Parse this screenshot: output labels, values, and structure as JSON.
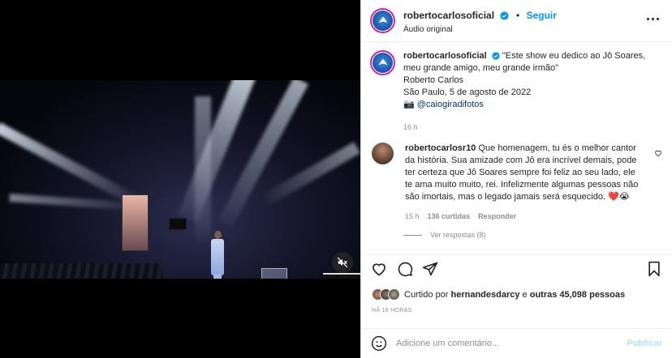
{
  "post": {
    "username": "robertocarlosoficial",
    "follow_label": "Seguir",
    "audio_label": "Áudio original",
    "separator": "•"
  },
  "caption": {
    "username": "robertocarlosoficial",
    "quote": "\"Este show eu dedico ao Jô Soares, meu grande amigo, meu grande irmão\"",
    "author": "Roberto Carlos",
    "place_date": "São Paulo, 5 de agosto de 2022",
    "camera_emoji": "📷",
    "mention": "@caiogiradifotos",
    "time": "16 h"
  },
  "comment": {
    "username": "robertocarlosr10",
    "text": "Que homenagem, tu és o melhor cantor da história. Sua amizade com Jô era incrível demais, pode ter certeza que Jô Soares sempre foi feliz ao seu lado, ele te ama muito muito, rei. Infelizmente algumas pessoas não são imortais, mas o legado jamais será esquecido.",
    "emojis": "❤️😭",
    "time": "15 h",
    "likes": "136 curtidas",
    "reply_label": "Responder",
    "view_replies": "Ver respostas (8)"
  },
  "likes": {
    "prefix": "Curtido por",
    "user": "hernandesdarcy",
    "middle": "e",
    "others": "outras 45,098 pessoas"
  },
  "post_time": "HÁ 16 HORAS",
  "add_comment": {
    "placeholder": "Adicione um comentário...",
    "publish_label": "Publicar"
  },
  "colors": {
    "accent": "#0095f6",
    "verified": "#0095f6",
    "publish_disabled": "#b2dffc",
    "avatar_ring": "#d6249f"
  },
  "icons": [
    "heart-icon",
    "comment-icon",
    "share-icon",
    "bookmark-icon",
    "emoji-icon",
    "more-options-icon",
    "verified-badge-icon",
    "mute-icon"
  ]
}
